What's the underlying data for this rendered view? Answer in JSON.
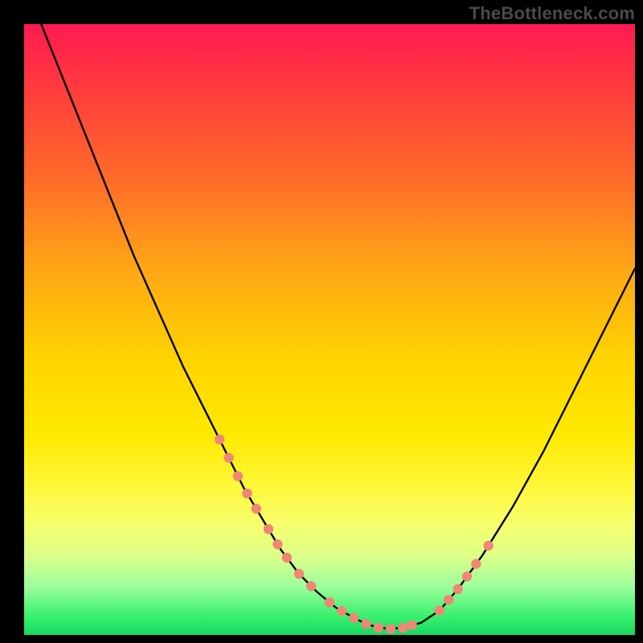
{
  "watermark": "TheBottleneck.com",
  "colors": {
    "background": "#000000",
    "gradient_top": "#ff1a52",
    "gradient_bottom": "#17d95f",
    "curve": "#000000",
    "markers": "#f08676"
  },
  "chart_data": {
    "type": "line",
    "title": "",
    "xlabel": "",
    "ylabel": "",
    "xlim": [
      0,
      100
    ],
    "ylim": [
      0,
      100
    ],
    "x": [
      2,
      6,
      10,
      14,
      18,
      22,
      26,
      30,
      33,
      36,
      39,
      42,
      45,
      48,
      51,
      54,
      56,
      58,
      60,
      62,
      65,
      68,
      71,
      75,
      80,
      85,
      90,
      95,
      100
    ],
    "values": [
      102,
      92,
      82,
      72,
      62,
      53,
      44,
      36,
      30,
      24,
      19,
      14,
      10,
      7,
      4.5,
      2.8,
      1.8,
      1.2,
      1.0,
      1.2,
      2.0,
      4.0,
      7.5,
      13,
      21,
      30,
      40,
      50,
      60
    ],
    "annotations": {
      "marker_groups": [
        {
          "side": "left",
          "x": [
            32,
            33.5,
            35,
            36.5,
            38,
            40,
            41.5,
            43,
            45,
            47
          ]
        },
        {
          "side": "floor",
          "x": [
            50,
            52,
            54,
            56,
            58,
            60,
            62,
            63.5
          ]
        },
        {
          "side": "right",
          "x": [
            68,
            69.5,
            71,
            72.5,
            74,
            76
          ]
        }
      ]
    }
  }
}
